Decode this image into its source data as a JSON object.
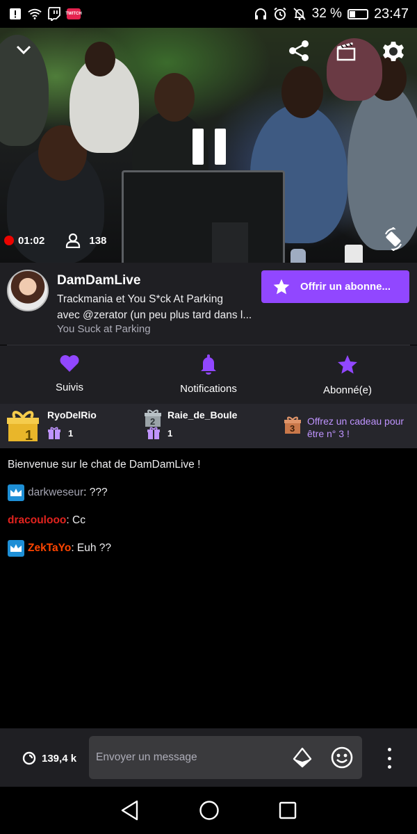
{
  "status_bar": {
    "app_badge": "TWITCH",
    "battery": "32 %",
    "battery_level": 0.32,
    "time": "23:47"
  },
  "video": {
    "uptime": "01:02",
    "viewers": "138"
  },
  "channel": {
    "name": "DamDamLive",
    "title_line1": "Trackmania et You S*ck At Parking",
    "title_line2": "avec @zerator (un peu plus tard dans l...",
    "game": "You Suck at Parking",
    "subscribe_label": "Offrir un abonne..."
  },
  "actions": [
    {
      "label": "Suivis"
    },
    {
      "label": "Notifications"
    },
    {
      "label": "Abonné(e)"
    }
  ],
  "gift_leaderboard": {
    "first": {
      "rank": "1",
      "name": "RyoDelRio",
      "count": "1"
    },
    "second": {
      "rank": "2",
      "name": "Raie_de_Boule",
      "count": "1"
    },
    "cta_rank": "3",
    "cta_line1": "Offrez un cadeau pour",
    "cta_line2": "être n° 3 !"
  },
  "chat": {
    "welcome": "Bienvenue sur le chat de DamDamLive !",
    "messages": [
      {
        "user": "darkweseur",
        "color": "#a3a3b0",
        "badge": true,
        "text": ": ???"
      },
      {
        "user": "dracoulooo",
        "color": "#e1231e",
        "badge": false,
        "text": ": Cc"
      },
      {
        "user": "ZekTaYo",
        "color": "#ff4500",
        "badge": true,
        "text": ": Euh ??"
      }
    ]
  },
  "input": {
    "points": "139,4 k",
    "placeholder": "Envoyer un message"
  },
  "colors": {
    "accent": "#9147ff",
    "accent_light": "#bf94ff",
    "live": "#eb0400"
  }
}
